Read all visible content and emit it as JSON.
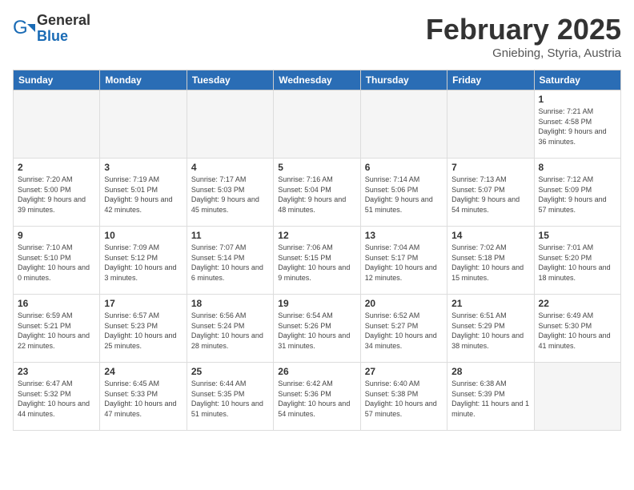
{
  "header": {
    "logo_general": "General",
    "logo_blue": "Blue",
    "title": "February 2025",
    "subtitle": "Gniebing, Styria, Austria"
  },
  "days_of_week": [
    "Sunday",
    "Monday",
    "Tuesday",
    "Wednesday",
    "Thursday",
    "Friday",
    "Saturday"
  ],
  "weeks": [
    [
      {
        "day": "",
        "info": ""
      },
      {
        "day": "",
        "info": ""
      },
      {
        "day": "",
        "info": ""
      },
      {
        "day": "",
        "info": ""
      },
      {
        "day": "",
        "info": ""
      },
      {
        "day": "",
        "info": ""
      },
      {
        "day": "1",
        "info": "Sunrise: 7:21 AM\nSunset: 4:58 PM\nDaylight: 9 hours and 36 minutes."
      }
    ],
    [
      {
        "day": "2",
        "info": "Sunrise: 7:20 AM\nSunset: 5:00 PM\nDaylight: 9 hours and 39 minutes."
      },
      {
        "day": "3",
        "info": "Sunrise: 7:19 AM\nSunset: 5:01 PM\nDaylight: 9 hours and 42 minutes."
      },
      {
        "day": "4",
        "info": "Sunrise: 7:17 AM\nSunset: 5:03 PM\nDaylight: 9 hours and 45 minutes."
      },
      {
        "day": "5",
        "info": "Sunrise: 7:16 AM\nSunset: 5:04 PM\nDaylight: 9 hours and 48 minutes."
      },
      {
        "day": "6",
        "info": "Sunrise: 7:14 AM\nSunset: 5:06 PM\nDaylight: 9 hours and 51 minutes."
      },
      {
        "day": "7",
        "info": "Sunrise: 7:13 AM\nSunset: 5:07 PM\nDaylight: 9 hours and 54 minutes."
      },
      {
        "day": "8",
        "info": "Sunrise: 7:12 AM\nSunset: 5:09 PM\nDaylight: 9 hours and 57 minutes."
      }
    ],
    [
      {
        "day": "9",
        "info": "Sunrise: 7:10 AM\nSunset: 5:10 PM\nDaylight: 10 hours and 0 minutes."
      },
      {
        "day": "10",
        "info": "Sunrise: 7:09 AM\nSunset: 5:12 PM\nDaylight: 10 hours and 3 minutes."
      },
      {
        "day": "11",
        "info": "Sunrise: 7:07 AM\nSunset: 5:14 PM\nDaylight: 10 hours and 6 minutes."
      },
      {
        "day": "12",
        "info": "Sunrise: 7:06 AM\nSunset: 5:15 PM\nDaylight: 10 hours and 9 minutes."
      },
      {
        "day": "13",
        "info": "Sunrise: 7:04 AM\nSunset: 5:17 PM\nDaylight: 10 hours and 12 minutes."
      },
      {
        "day": "14",
        "info": "Sunrise: 7:02 AM\nSunset: 5:18 PM\nDaylight: 10 hours and 15 minutes."
      },
      {
        "day": "15",
        "info": "Sunrise: 7:01 AM\nSunset: 5:20 PM\nDaylight: 10 hours and 18 minutes."
      }
    ],
    [
      {
        "day": "16",
        "info": "Sunrise: 6:59 AM\nSunset: 5:21 PM\nDaylight: 10 hours and 22 minutes."
      },
      {
        "day": "17",
        "info": "Sunrise: 6:57 AM\nSunset: 5:23 PM\nDaylight: 10 hours and 25 minutes."
      },
      {
        "day": "18",
        "info": "Sunrise: 6:56 AM\nSunset: 5:24 PM\nDaylight: 10 hours and 28 minutes."
      },
      {
        "day": "19",
        "info": "Sunrise: 6:54 AM\nSunset: 5:26 PM\nDaylight: 10 hours and 31 minutes."
      },
      {
        "day": "20",
        "info": "Sunrise: 6:52 AM\nSunset: 5:27 PM\nDaylight: 10 hours and 34 minutes."
      },
      {
        "day": "21",
        "info": "Sunrise: 6:51 AM\nSunset: 5:29 PM\nDaylight: 10 hours and 38 minutes."
      },
      {
        "day": "22",
        "info": "Sunrise: 6:49 AM\nSunset: 5:30 PM\nDaylight: 10 hours and 41 minutes."
      }
    ],
    [
      {
        "day": "23",
        "info": "Sunrise: 6:47 AM\nSunset: 5:32 PM\nDaylight: 10 hours and 44 minutes."
      },
      {
        "day": "24",
        "info": "Sunrise: 6:45 AM\nSunset: 5:33 PM\nDaylight: 10 hours and 47 minutes."
      },
      {
        "day": "25",
        "info": "Sunrise: 6:44 AM\nSunset: 5:35 PM\nDaylight: 10 hours and 51 minutes."
      },
      {
        "day": "26",
        "info": "Sunrise: 6:42 AM\nSunset: 5:36 PM\nDaylight: 10 hours and 54 minutes."
      },
      {
        "day": "27",
        "info": "Sunrise: 6:40 AM\nSunset: 5:38 PM\nDaylight: 10 hours and 57 minutes."
      },
      {
        "day": "28",
        "info": "Sunrise: 6:38 AM\nSunset: 5:39 PM\nDaylight: 11 hours and 1 minute."
      },
      {
        "day": "",
        "info": ""
      }
    ]
  ]
}
